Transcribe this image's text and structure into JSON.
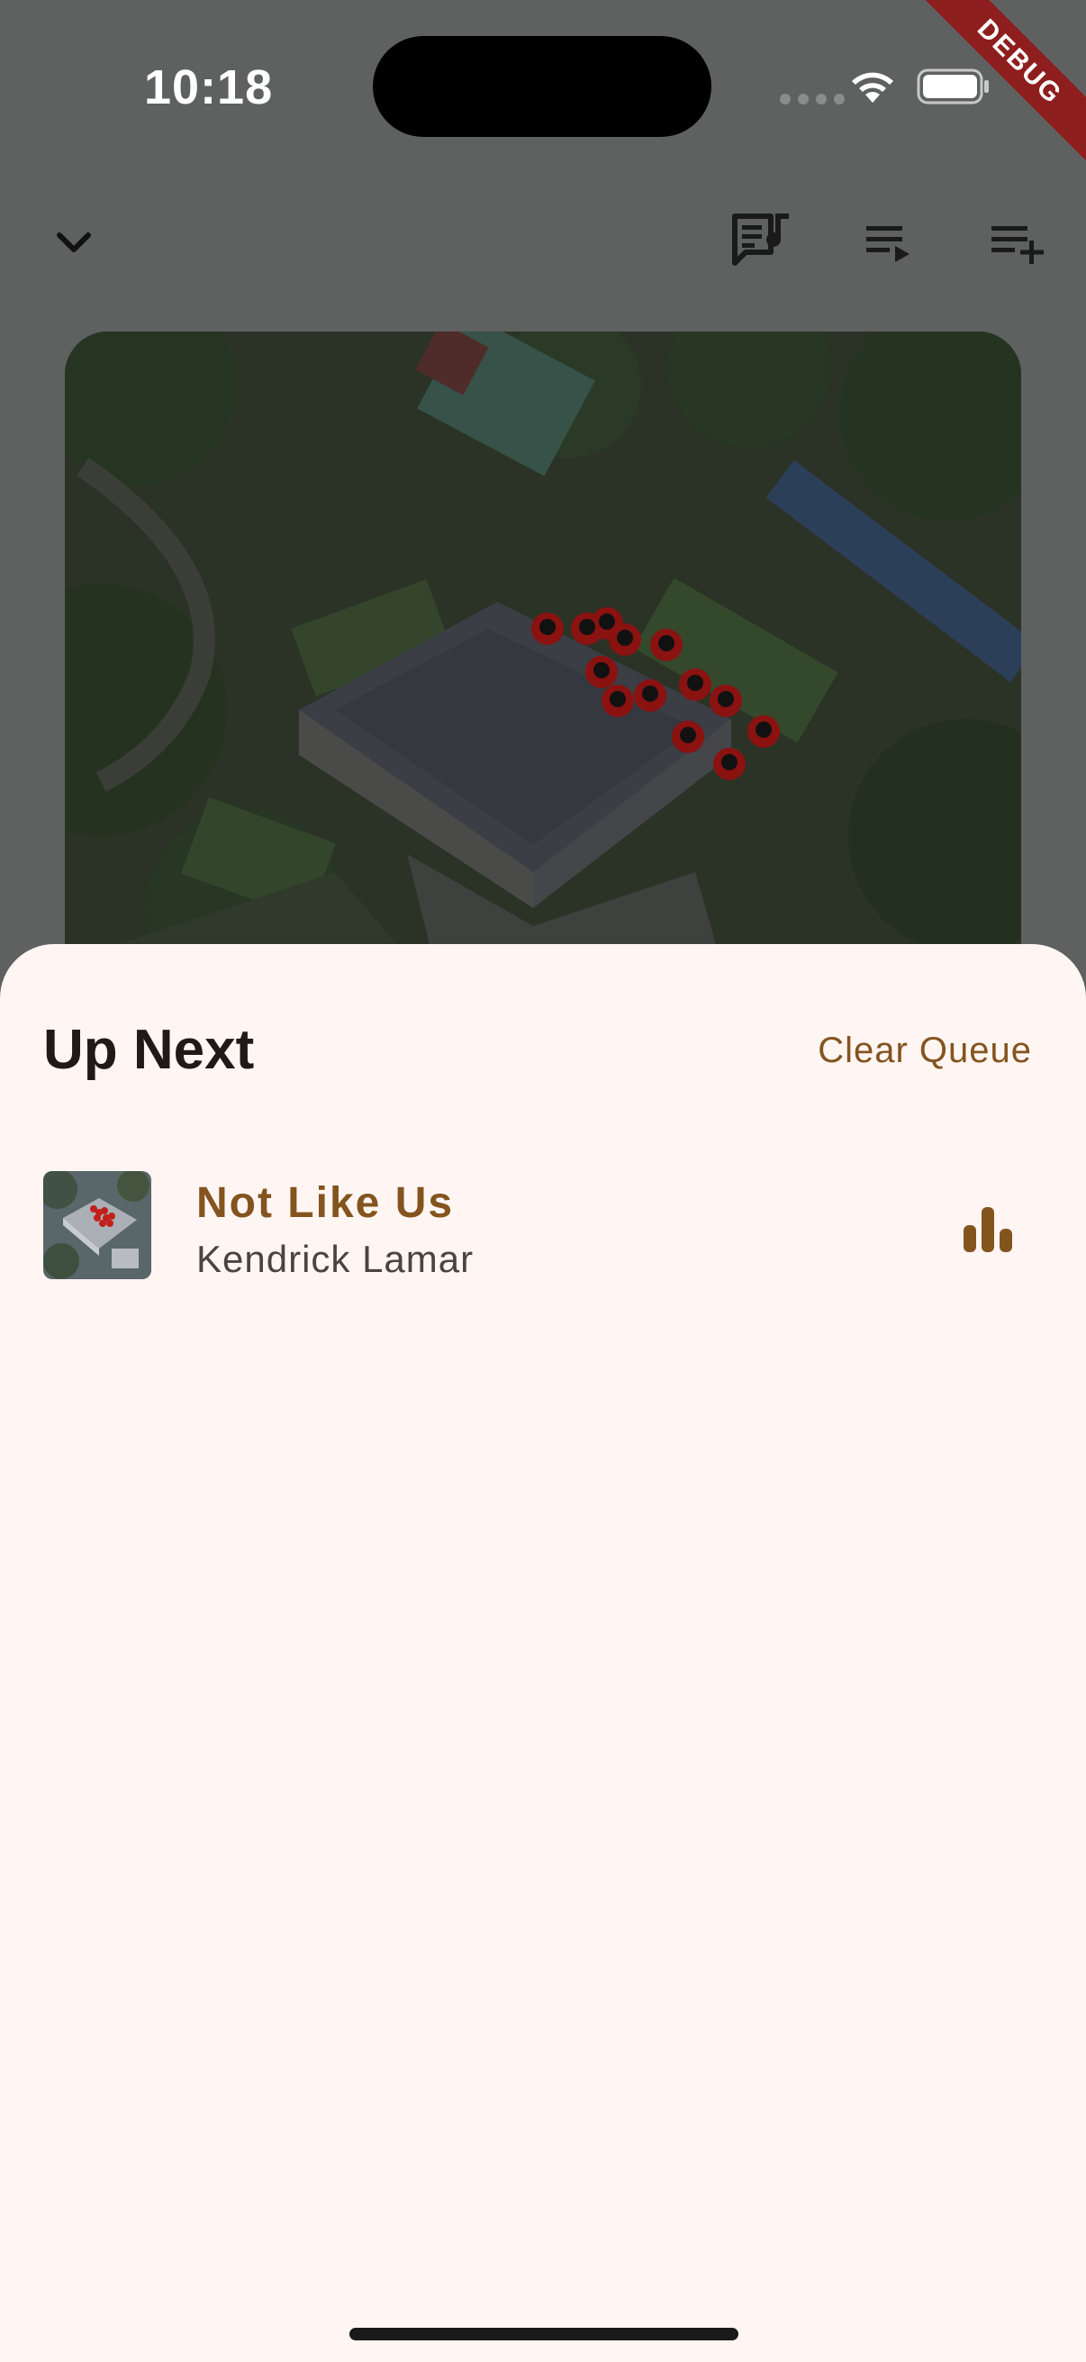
{
  "status_bar": {
    "time": "10:18",
    "debug_label": "DEBUG"
  },
  "toolbar": {
    "icons": [
      "chevron-down-icon",
      "lyrics-icon",
      "queue-icon",
      "playlist-add-icon"
    ]
  },
  "queue_sheet": {
    "title": "Up Next",
    "clear_label": "Clear Queue",
    "tracks": [
      {
        "title": "Not Like Us",
        "artist": "Kendrick Lamar",
        "now_playing_icon": "equalizer-icon"
      }
    ]
  },
  "colors": {
    "accent": "#84541f",
    "sheet_background": "#fff6f3",
    "overlay_background": "#5f6060",
    "debug_banner": "#8e1e1e"
  }
}
